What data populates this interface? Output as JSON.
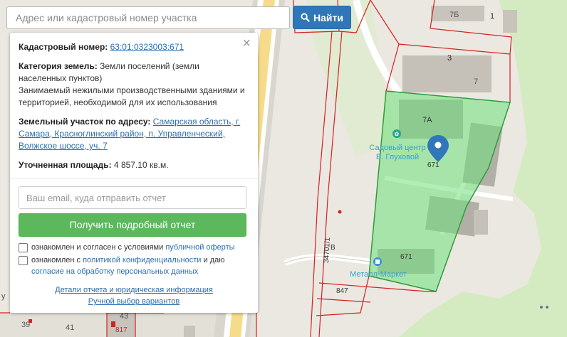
{
  "search": {
    "placeholder": "Адрес или кадастровый номер участка",
    "button_label": "Найти"
  },
  "panel": {
    "close_symbol": "×",
    "cadastral_label": "Кадастровый номер:",
    "cadastral_number": "63:01:0323003:671",
    "category_label": "Категория земель:",
    "category_value": "Земли поселений (земли населенных пунктов)",
    "usage_value": "Занимаемый нежилыми производственными зданиями и территорией, необходимой для их использования",
    "address_label": "Земельный участок по адресу:",
    "address_value": "Самарская область, г. Самара, Красноглинский район, п. Управленческий, Волжское шоссе, уч. 7",
    "area_label": "Уточненная площадь:",
    "area_value": "4 857.10 кв.м.",
    "email_placeholder": "Ваш email, куда отправить отчет",
    "report_button": "Получить подробный отчет",
    "consent1_text": "ознакомлен и согласен с условиями",
    "consent1_link": "публичной оферты",
    "consent2_text": "ознакомлен с",
    "consent2_link": "политикой конфиденциальности",
    "consent2_mid": "и даю",
    "consent2_link2": "согласие на обработку персональных данных",
    "details_link": "Детали отчета и юридическая информация",
    "manual_link": "Ручной выбор вариантов"
  },
  "map": {
    "parcel_color": "#6fe07c",
    "boundary_color": "#d42121",
    "labels": {
      "l7b": "7Б",
      "l1": "1",
      "l3": "3",
      "l7": "7",
      "l7a": "7А",
      "l671a": "671",
      "l671b": "671",
      "l847": "847",
      "l34701": "34701/1",
      "lB": "В",
      "l39": "39",
      "l41": "41",
      "l43": "43",
      "l817": "817",
      "ly": "у"
    },
    "pois": {
      "garden_line1": "Садовый центр",
      "garden_line2": "В. Глуховой",
      "metal_market": "Металл-Маркет"
    }
  }
}
